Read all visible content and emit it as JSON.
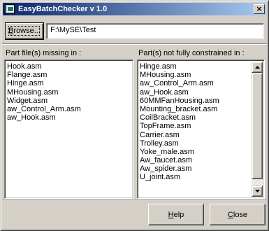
{
  "window": {
    "title": "EasyBatchChecker v 1.0",
    "close_glyph": "×"
  },
  "toolbar": {
    "browse_label_pre": "",
    "browse_label_u": "B",
    "browse_label_post": "rowse...",
    "path_value": "F:\\MySE\\Test"
  },
  "missing_panel": {
    "label": "Part file(s) missing in :",
    "items": [
      "Hook.asm",
      "Flange.asm",
      "Hinge.asm",
      "MHousing.asm",
      "Widget.asm",
      "aw_Control_Arm.asm",
      "aw_Hook.asm"
    ]
  },
  "constrained_panel": {
    "label": "Part(s) not fully constrained in :",
    "items": [
      "Hinge.asm",
      "MHousing.asm",
      "aw_Control_Arm.asm",
      "aw_Hook.asm",
      "60MMFanHousing.asm",
      "Mounting_bracket.asm",
      "CoilBracket.asm",
      "TopFrame.asm",
      "Carrier.asm",
      "Trolley.asm",
      "Yoke_male.asm",
      "Aw_faucet.asm",
      "Aw_spider.asm",
      "U_joint.asm"
    ]
  },
  "footer": {
    "help_u": "H",
    "help_rest": "elp",
    "close_u": "C",
    "close_rest": "lose"
  },
  "icons": {
    "app": "app-window-icon",
    "scroll_up": "scroll-up-arrow-icon",
    "scroll_down": "scroll-down-arrow-icon"
  },
  "colors": {
    "titlebar_start": "#0a246a",
    "titlebar_end": "#a6caf0",
    "face": "#d4d0c8"
  }
}
